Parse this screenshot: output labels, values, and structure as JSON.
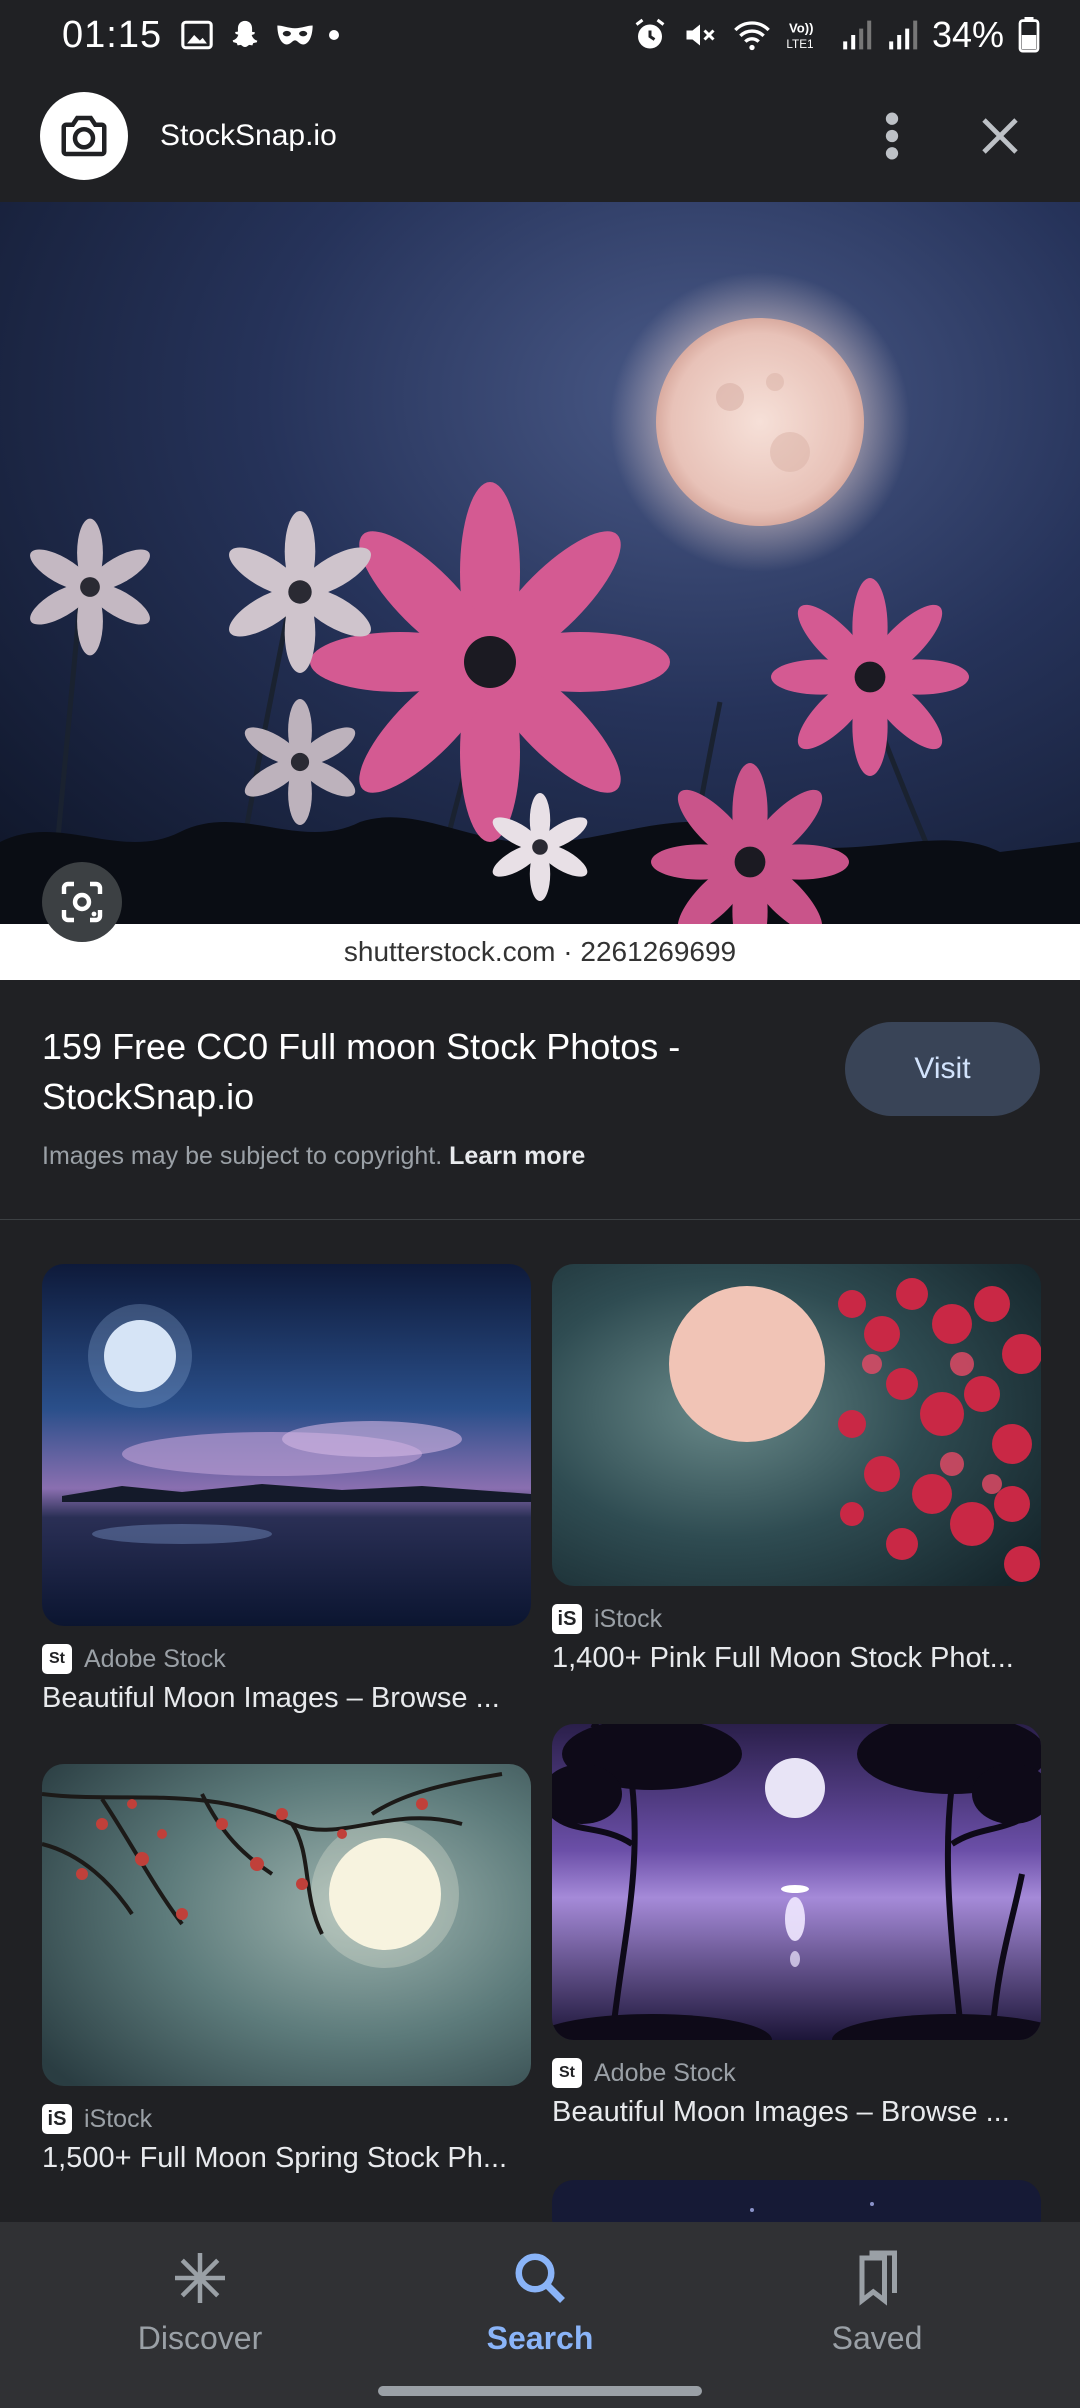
{
  "status_bar": {
    "time": "01:15",
    "battery": "34%"
  },
  "header": {
    "site_name": "StockSnap.io"
  },
  "hero": {
    "watermark": "shutterstock.com · 2261269699"
  },
  "info": {
    "title": "159 Free CC0 Full moon Stock Photos - StockSnap.io",
    "visit_label": "Visit",
    "copyright_text": "Images may be subject to copyright. ",
    "learn_more_label": "Learn more"
  },
  "results": [
    {
      "source": "Adobe Stock",
      "source_logo": "St",
      "title": "Beautiful Moon Images – Browse ..."
    },
    {
      "source": "iStock",
      "source_logo": "iS",
      "title": "1,400+ Pink Full Moon Stock Phot..."
    },
    {
      "source": "iStock",
      "source_logo": "iS",
      "title": "1,500+ Full Moon Spring Stock Ph..."
    },
    {
      "source": "Adobe Stock",
      "source_logo": "St",
      "title": "Beautiful Moon Images – Browse ..."
    }
  ],
  "bottom_nav": {
    "items": [
      {
        "label": "Discover",
        "icon": "asterisk-icon"
      },
      {
        "label": "Search",
        "icon": "search-icon"
      },
      {
        "label": "Saved",
        "icon": "bookmarks-icon"
      }
    ],
    "active": "Search"
  },
  "colors": {
    "background": "#202124",
    "accent": "#8ab4f8",
    "visit_button": "#394457"
  }
}
